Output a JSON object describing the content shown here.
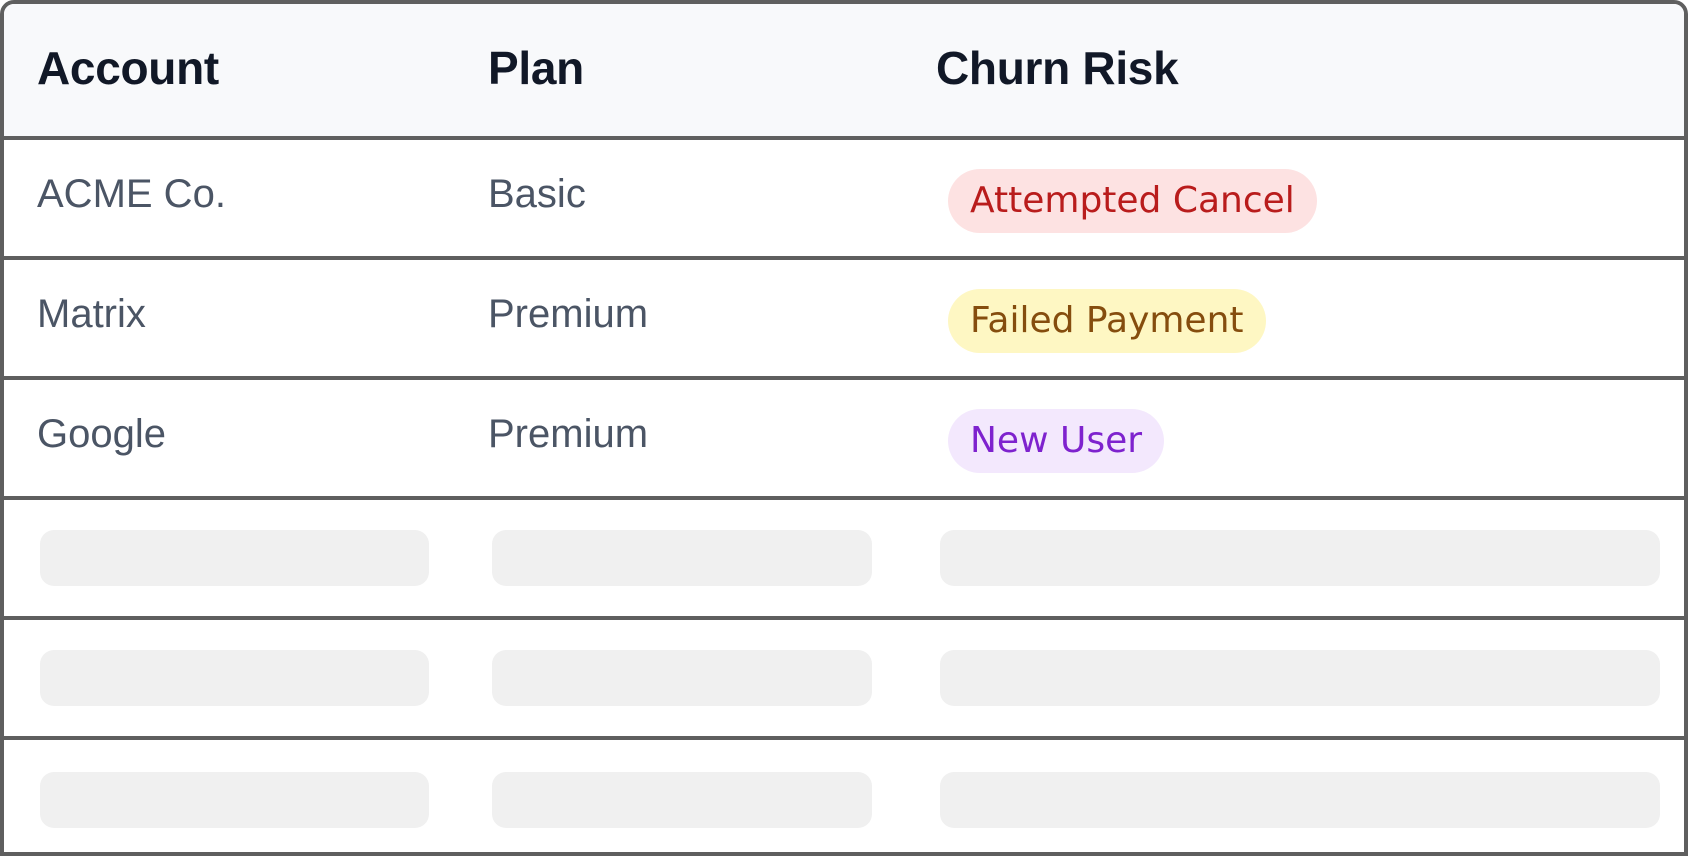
{
  "table": {
    "columns": [
      "Account",
      "Plan",
      "Churn Risk"
    ],
    "rows": [
      {
        "account": "ACME Co.",
        "plan": "Basic",
        "churn_risk": {
          "label": "Attempted Cancel",
          "bg": "#fde2e2",
          "fg": "#b91c1c"
        }
      },
      {
        "account": "Matrix",
        "plan": "Premium",
        "churn_risk": {
          "label": "Failed Payment",
          "bg": "#fef7c3",
          "fg": "#854d0e"
        }
      },
      {
        "account": "Google",
        "plan": "Premium",
        "churn_risk": {
          "label": "New User",
          "bg": "#f3e8fd",
          "fg": "#7e22ce"
        }
      }
    ],
    "loading_rows": 3
  },
  "colors": {
    "border": "#5f5f5f",
    "header_bg": "#f8f9fb",
    "header_text": "#111827",
    "body_text": "#4b5565",
    "skeleton": "#f0f0f0"
  }
}
